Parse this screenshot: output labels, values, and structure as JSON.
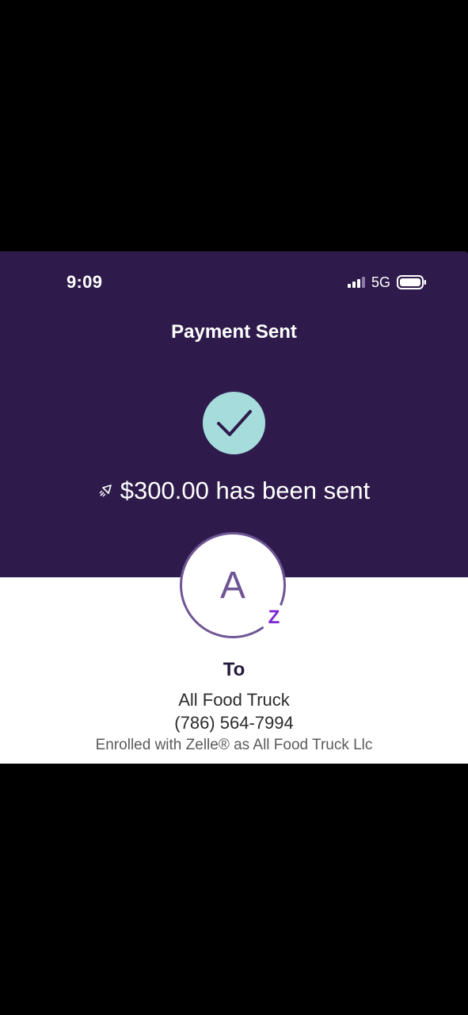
{
  "status_bar": {
    "time": "9:09",
    "network": "5G",
    "signal_icon": "signal-bars-icon",
    "battery_icon": "battery-icon"
  },
  "header": {
    "title": "Payment Sent"
  },
  "confirmation": {
    "icon": "checkmark-icon",
    "sent_icon": "rocket-icon",
    "message": "$300.00 has been sent"
  },
  "recipient": {
    "avatar_initial": "A",
    "badge_icon": "zelle-icon",
    "badge_text": "Z",
    "to_label": "To",
    "name": "All Food Truck",
    "phone": "(786) 564-7994",
    "enrolled_note": "Enrolled with Zelle® as All Food Truck Llc"
  },
  "colors": {
    "header_bg": "#2e1b4b",
    "check_circle": "#a6dcdc",
    "avatar_ring": "#6f5594",
    "zelle_purple": "#7b27d6"
  }
}
